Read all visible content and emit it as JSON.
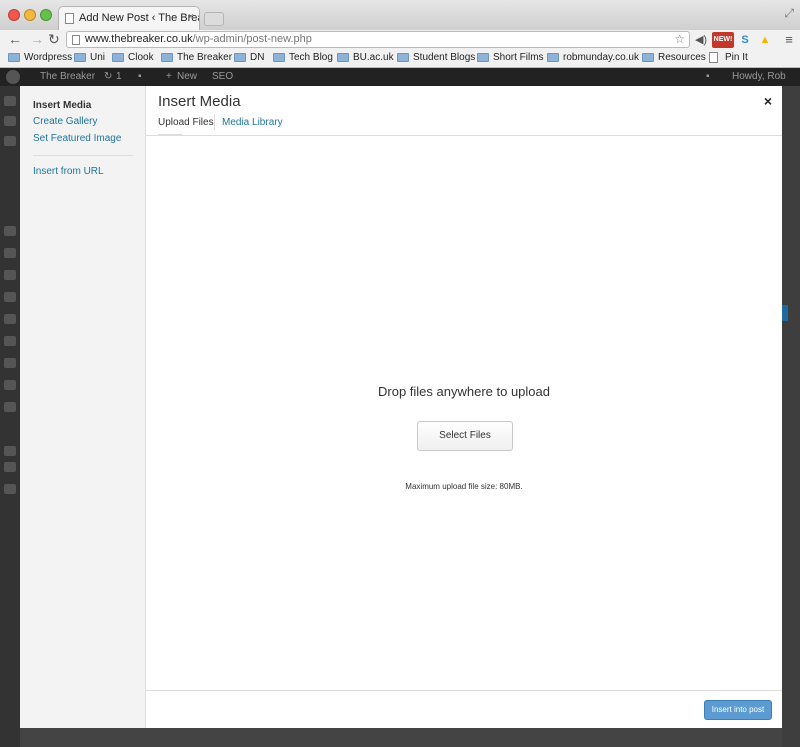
{
  "browser": {
    "tab_title": "Add New Post ‹ The Breaker",
    "tab_close": "×",
    "url_domain": "www.thebreaker.co.uk",
    "url_path": "/wp-admin/post-new.php",
    "extension_badge": "NEW!",
    "bookmarks": [
      "Wordpress",
      "Uni",
      "Clook",
      "The Breaker",
      "DN",
      "Tech Blog",
      "BU.ac.uk",
      "Student Blogs",
      "Short Films",
      "robmunday.co.uk",
      "Resources",
      "Pin It"
    ]
  },
  "adminbar": {
    "site_name": "The Breaker",
    "updates": "1",
    "new_label": "New",
    "seo_label": "SEO",
    "greeting": "Howdy, Rob"
  },
  "modal": {
    "title": "Insert Media",
    "close": "×",
    "menu": {
      "insert_media": "Insert Media",
      "create_gallery": "Create Gallery",
      "set_featured": "Set Featured Image",
      "insert_url": "Insert from URL"
    },
    "router": {
      "upload": "Upload Files",
      "library": "Media Library"
    },
    "upload": {
      "drop_message": "Drop files anywhere to upload",
      "select_button": "Select Files",
      "max_size": "Maximum upload file size: 80MB."
    },
    "footer": {
      "insert_button": "Insert into post"
    }
  },
  "colors": {
    "link": "#21759b",
    "primary_button": "#5b9bd1",
    "adminbar": "#222222"
  }
}
